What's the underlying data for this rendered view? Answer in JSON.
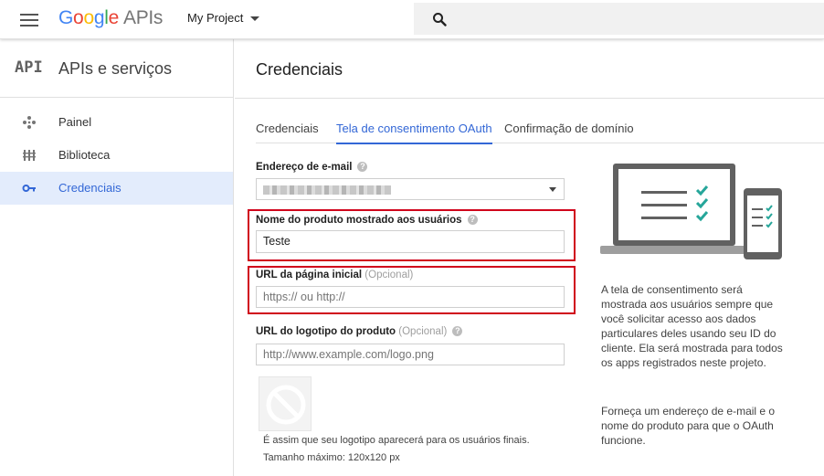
{
  "header": {
    "logo_google": [
      "G",
      "o",
      "o",
      "g",
      "l",
      "e"
    ],
    "logo_apis": "APIs",
    "project_name": "My Project"
  },
  "sidebar": {
    "badge": "API",
    "title": "APIs e serviços",
    "items": [
      {
        "label": "Painel",
        "icon": "dashboard-icon",
        "active": false
      },
      {
        "label": "Biblioteca",
        "icon": "library-icon",
        "active": false
      },
      {
        "label": "Credenciais",
        "icon": "key-icon",
        "active": true
      }
    ]
  },
  "main": {
    "title": "Credenciais",
    "tabs": [
      {
        "label": "Credenciais",
        "active": false
      },
      {
        "label": "Tela de consentimento OAuth",
        "active": true
      },
      {
        "label": "Confirmação de domínio",
        "active": false
      }
    ],
    "form": {
      "email_label": "Endereço de e-mail",
      "product_name_label": "Nome do produto mostrado aos usuários",
      "product_name_value": "Teste",
      "homepage_label": "URL da página inicial",
      "homepage_optional": "(Opcional)",
      "homepage_placeholder": "https:// ou http://",
      "logo_url_label": "URL do logotipo do produto",
      "logo_url_optional": "(Opcional)",
      "logo_url_placeholder": "http://www.example.com/logo.png",
      "logo_note": "É assim que seu logotipo aparecerá para os usuários finais.",
      "logo_max_size": "Tamanho máximo: 120x120 px"
    },
    "info": {
      "paragraph1": "A tela de consentimento será mostrada aos usuários sempre que você solicitar acesso aos dados particulares deles usando seu ID do cliente. Ela será mostrada para todos os apps registrados neste projeto.",
      "paragraph2": "Forneça um endereço de e-mail e o nome do produto para que o OAuth funcione."
    }
  },
  "colors": {
    "accent": "#3367d6",
    "highlight": "#d0021b",
    "check": "#26a69a"
  }
}
